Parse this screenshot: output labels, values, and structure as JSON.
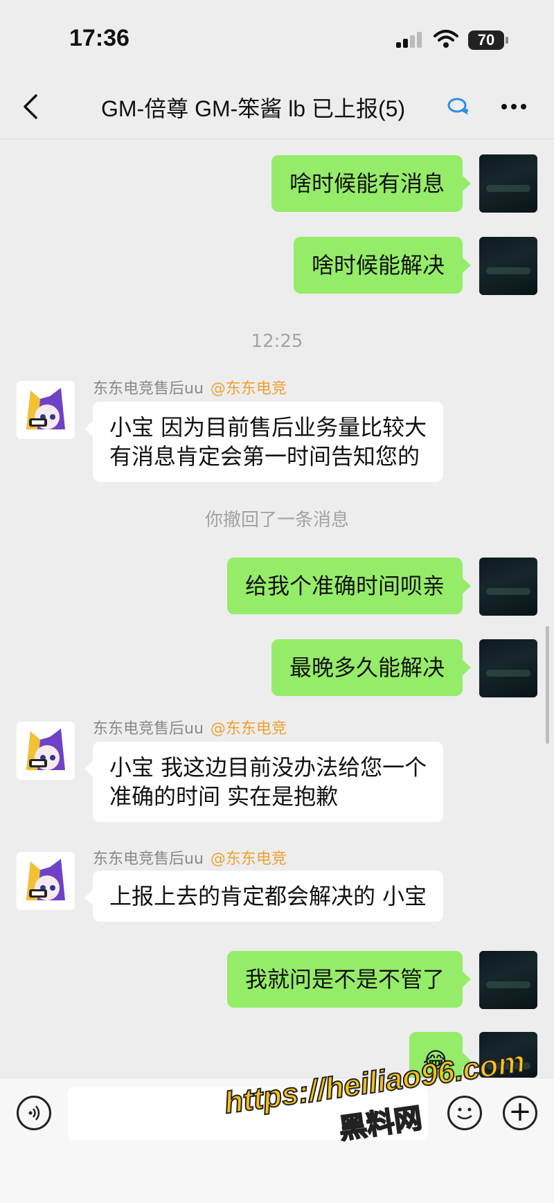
{
  "status_bar": {
    "time": "17:36",
    "battery": "70"
  },
  "header": {
    "title": "GM-倍尊 GM-笨酱 lb 已上报(5)"
  },
  "messages": {
    "m1": {
      "text": "啥时候能有消息"
    },
    "m2": {
      "text": "啥时候能解决"
    },
    "time1": {
      "text": "12:25"
    },
    "m3": {
      "sender": "东东电竞售后uu",
      "tag": "@东东电竞",
      "line1": "小宝 因为目前售后业务量比较大",
      "line2": "有消息肯定会第一时间告知您的"
    },
    "recall": {
      "text": "你撤回了一条消息"
    },
    "m4": {
      "text": "给我个准确时间呗亲"
    },
    "m5": {
      "text": "最晚多久能解决"
    },
    "m6": {
      "sender": "东东电竞售后uu",
      "tag": "@东东电竞",
      "line1": "小宝 我这边目前没办法给您一个",
      "line2": "准确的时间 实在是抱歉"
    },
    "m7": {
      "sender": "东东电竞售后uu",
      "tag": "@东东电竞",
      "line1": "上报上去的肯定都会解决的 小宝"
    },
    "m8": {
      "text": "我就问是不是不管了"
    },
    "m9": {
      "text": "😂"
    }
  },
  "input": {
    "value": ""
  },
  "watermark": {
    "url": "https://heiliao96.com",
    "name": "黑料网"
  },
  "colors": {
    "my_bubble": "#95ec69",
    "their_bubble": "#ffffff",
    "background": "#ededed",
    "tag": "#f0a030"
  },
  "icons": {
    "back": "chevron-left-icon",
    "more": "more-dots-icon",
    "voice": "voice-icon",
    "emoji": "emoji-icon",
    "plus": "plus-icon",
    "group_chat": "group-chat-icon"
  }
}
